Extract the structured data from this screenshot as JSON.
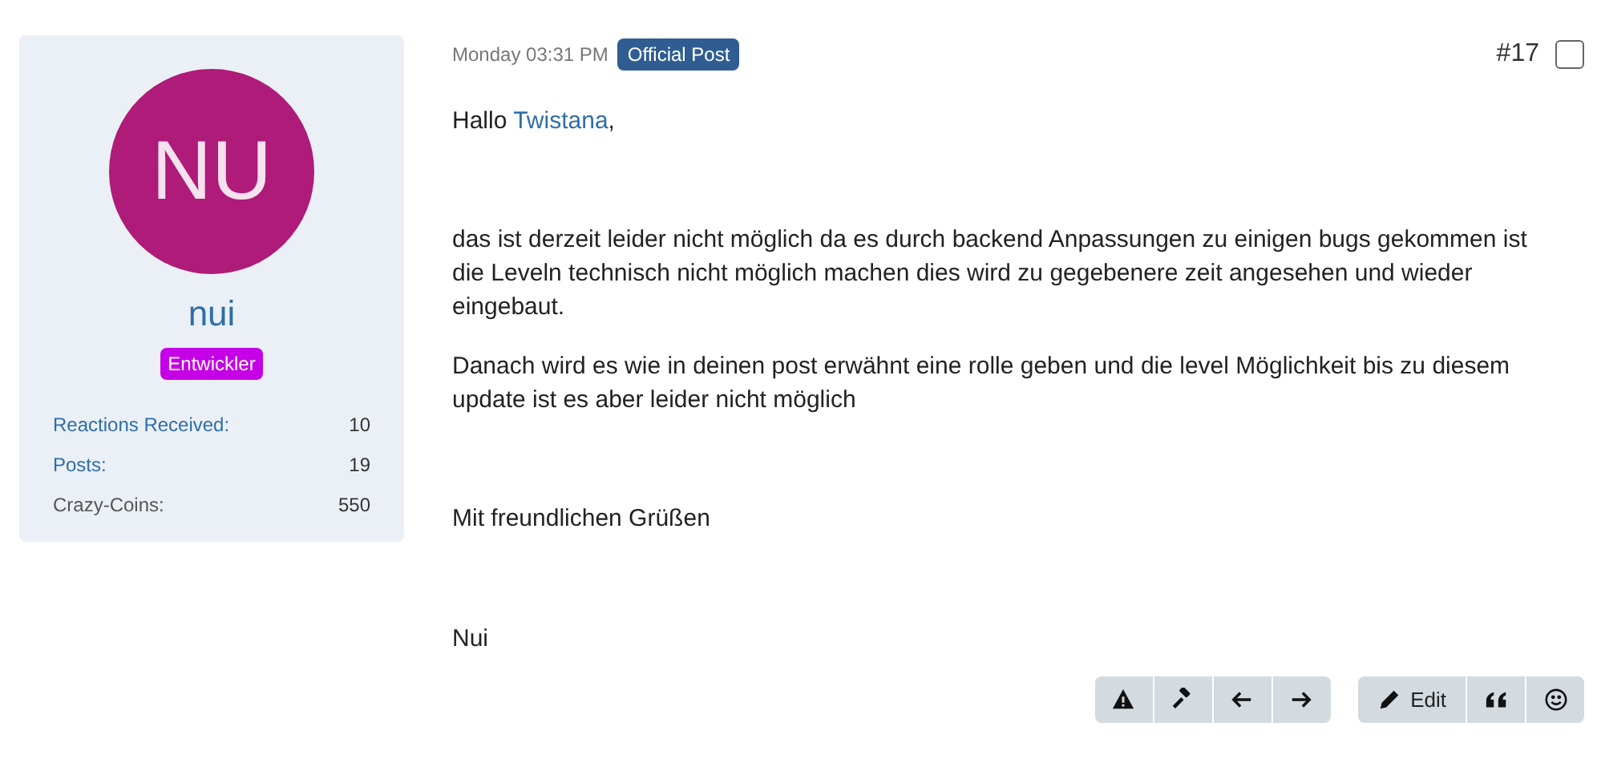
{
  "author": {
    "initials": "NU",
    "name": "nui",
    "role_badge": "Entwickler",
    "stats": [
      {
        "label": "Reactions Received:",
        "value": "10",
        "link": true
      },
      {
        "label": "Posts:",
        "value": "19",
        "link": true
      },
      {
        "label": "Crazy-Coins:",
        "value": "550",
        "link": false
      }
    ]
  },
  "post": {
    "time": "Monday 03:31 PM",
    "badge": "Official Post",
    "number": "#17",
    "checked": false,
    "greeting": {
      "prefix": "Hallo ",
      "link": "Twistana",
      "suffix": ","
    },
    "paragraphs": [
      "das ist derzeit leider nicht möglich da es durch backend Anpassungen zu einigen bugs gekommen ist die Leveln technisch nicht möglich machen dies wird zu gegebenere zeit angesehen und wieder eingebaut.",
      "Danach wird es wie in deinen post erwähnt eine rolle geben und die level Möglichkeit bis zu diesem update ist es aber leider nicht möglich"
    ],
    "closing": "Mit freundlichen Grüßen",
    "signature": "Nui"
  },
  "action_groups": [
    [
      {
        "kind": "report"
      },
      {
        "kind": "moderate"
      },
      {
        "kind": "previous"
      },
      {
        "kind": "next"
      }
    ],
    [
      {
        "kind": "edit",
        "label": "Edit"
      },
      {
        "kind": "quote"
      },
      {
        "kind": "react"
      }
    ]
  ]
}
